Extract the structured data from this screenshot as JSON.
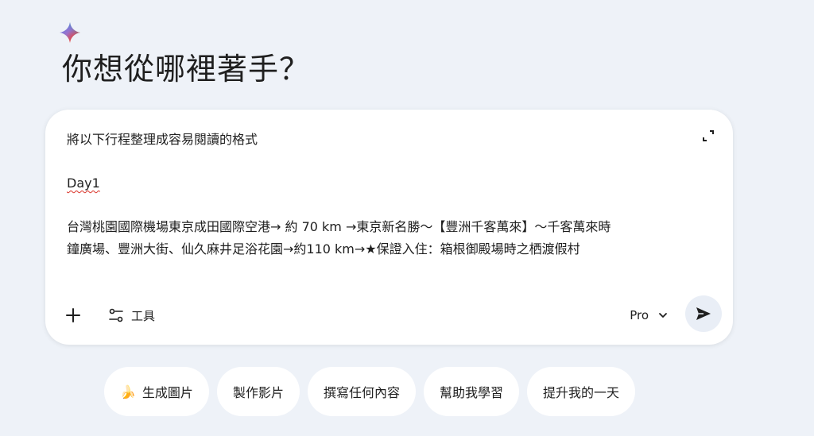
{
  "header": {
    "heading": "你想從哪裡著手？",
    "spark_icon": "gemini-spark-icon"
  },
  "composer": {
    "lines": [
      "將以下行程整理成容易閱讀的格式",
      "",
      "Day1",
      "",
      "台灣桃園國際機場東京成田國際空港→ 約 70 km →東京新名勝～【豐洲千客萬來】～千客萬來時",
      "鐘廣場、豐洲大街、仙久麻井足浴花園→約110 km→★保證入住：箱根御殿場時之栖渡假村"
    ],
    "tools_label": "工具",
    "model_label": "Pro",
    "icons": {
      "expand": "expand-icon",
      "add": "plus-icon",
      "tools": "tools-icon",
      "dropdown": "chevron-down-icon",
      "send": "send-icon"
    }
  },
  "chips": [
    {
      "emoji": "🍌",
      "label": "生成圖片"
    },
    {
      "emoji": "",
      "label": "製作影片"
    },
    {
      "emoji": "",
      "label": "撰寫任何內容"
    },
    {
      "emoji": "",
      "label": "幫助我學習"
    },
    {
      "emoji": "",
      "label": "提升我的一天"
    }
  ],
  "colors": {
    "background": "#eef2f8",
    "card": "#ffffff",
    "send_button_bg": "#e9eef6",
    "text": "#1f1f1f",
    "spellcheck": "#d93025"
  }
}
